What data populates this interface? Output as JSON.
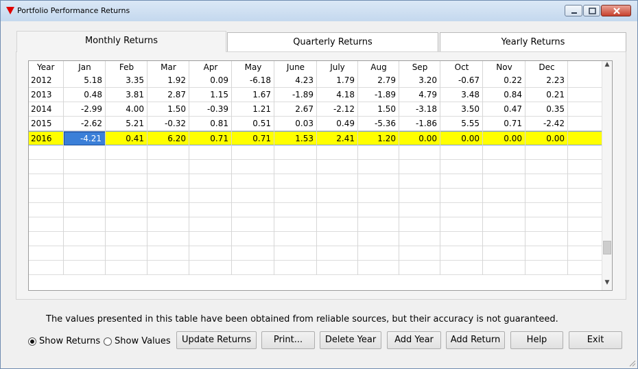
{
  "window": {
    "title": "Portfolio Performance Returns"
  },
  "tabs": [
    "Monthly Returns",
    "Quarterly Returns",
    "Yearly Returns"
  ],
  "table": {
    "columns": [
      "Year",
      "Jan",
      "Feb",
      "Mar",
      "Apr",
      "May",
      "June",
      "July",
      "Aug",
      "Sep",
      "Oct",
      "Nov",
      "Dec"
    ],
    "rows": [
      [
        "2012",
        "5.18",
        "3.35",
        "1.92",
        "0.09",
        "-6.18",
        "4.23",
        "1.79",
        "2.79",
        "3.20",
        "-0.67",
        "0.22",
        "2.23"
      ],
      [
        "2013",
        "0.48",
        "3.81",
        "2.87",
        "1.15",
        "1.67",
        "-1.89",
        "4.18",
        "-1.89",
        "4.79",
        "3.48",
        "0.84",
        "0.21"
      ],
      [
        "2014",
        "-2.99",
        "4.00",
        "1.50",
        "-0.39",
        "1.21",
        "2.67",
        "-2.12",
        "1.50",
        "-3.18",
        "3.50",
        "0.47",
        "0.35"
      ],
      [
        "2015",
        "-2.62",
        "5.21",
        "-0.32",
        "0.81",
        "0.51",
        "0.03",
        "0.49",
        "-5.36",
        "-1.86",
        "5.55",
        "0.71",
        "-2.42"
      ],
      [
        "2016",
        "-4.21",
        "0.41",
        "6.20",
        "0.71",
        "0.71",
        "1.53",
        "2.41",
        "1.20",
        "0.00",
        "0.00",
        "0.00",
        "0.00"
      ]
    ]
  },
  "disclaimer": "The values presented in this table have been obtained from reliable sources, but their accuracy is not guaranteed.",
  "radios": {
    "show_returns": "Show Returns",
    "show_values": "Show Values"
  },
  "buttons": {
    "update": "Update Returns",
    "print": "Print...",
    "delete_year": "Delete Year",
    "add_year": "Add Year",
    "add_return": "Add Return",
    "help": "Help",
    "exit": "Exit"
  },
  "colors": {
    "selected_row": "#ffff00",
    "focused_cell": "#3b7fd8",
    "close_button": "#c7412e"
  }
}
